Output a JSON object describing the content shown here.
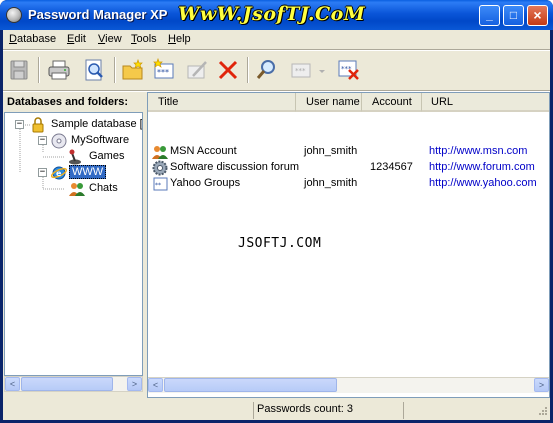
{
  "window": {
    "title": "Password Manager XP",
    "watermark": "WwW.JsofTJ.CoM",
    "controls": {
      "minimize": "_",
      "maximize": "□",
      "close": "×"
    }
  },
  "menu": {
    "items": [
      {
        "label": "Database",
        "underline": "D",
        "rest": "atabase"
      },
      {
        "label": "Edit",
        "underline": "E",
        "rest": "dit"
      },
      {
        "label": "View",
        "underline": "V",
        "rest": "iew"
      },
      {
        "label": "Tools",
        "underline": "T",
        "rest": "ools"
      },
      {
        "label": "Help",
        "underline": "H",
        "rest": "elp"
      }
    ]
  },
  "toolbar": {
    "icons": [
      "save-icon",
      "print-icon",
      "print-preview-icon",
      "new-folder-icon",
      "new-password-icon",
      "edit-icon",
      "delete-icon",
      "find-icon",
      "generator-icon",
      "dropdown-arrow-icon",
      "lock-icon"
    ]
  },
  "left_pane": {
    "header": "Databases and folders:",
    "tree": [
      {
        "label": "Sample database [p",
        "icon": "database-lock-icon",
        "expander": "−"
      },
      {
        "label": "MySoftware",
        "icon": "cd-icon",
        "expander": "−"
      },
      {
        "label": "Games",
        "icon": "joystick-icon"
      },
      {
        "label": "WWW",
        "icon": "internet-explorer-icon",
        "expander": "−",
        "selected": true
      },
      {
        "label": "Chats",
        "icon": "users-icon"
      }
    ]
  },
  "list": {
    "columns": [
      "Title",
      "User name",
      "Account",
      "URL"
    ],
    "rows": [
      {
        "title": "MSN Account",
        "user": "john_smith",
        "account": "",
        "url": "http://www.msn.com",
        "icon": "msn-users-icon"
      },
      {
        "title": "Software discussion forum",
        "user": "",
        "account": "1234567",
        "url": "http://www.forum.com",
        "icon": "gear-icon"
      },
      {
        "title": "Yahoo Groups",
        "user": "john_smith",
        "account": "",
        "url": "http://www.yahoo.com",
        "icon": "password-card-icon"
      }
    ],
    "watermark": "JSOFTJ.COM"
  },
  "status": {
    "text": "Passwords count: 3"
  },
  "scroll": {
    "left": "<",
    "right": ">"
  }
}
